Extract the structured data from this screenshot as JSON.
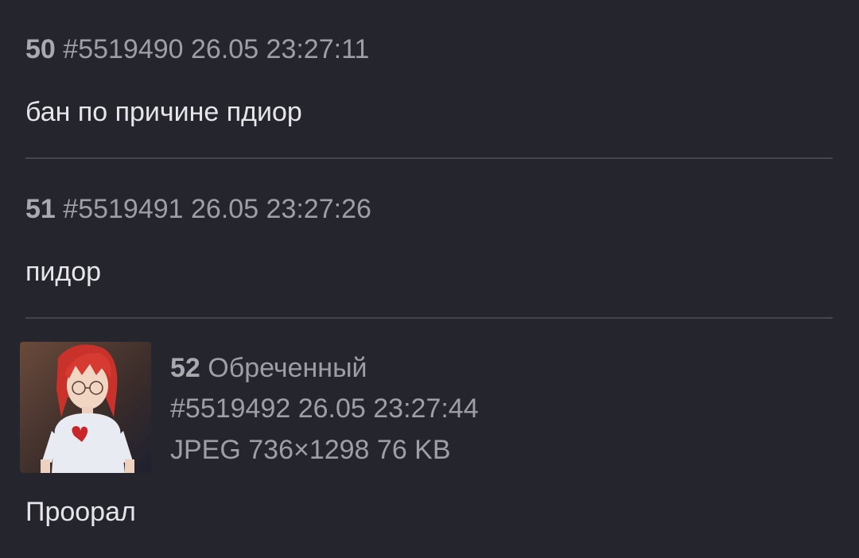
{
  "posts": [
    {
      "number": "50",
      "id": "#5519490",
      "datetime": "26.05 23:27:11",
      "text": "бан по причине пдиор"
    },
    {
      "number": "51",
      "id": "#5519491",
      "datetime": "26.05 23:27:26",
      "text": "пидор"
    },
    {
      "number": "52",
      "name": "Обреченный",
      "id": "#5519492",
      "datetime": "26.05 23:27:44",
      "file_info": "JPEG 736×1298 76 KB",
      "text": "Проорал"
    }
  ],
  "colors": {
    "background": "#25252d",
    "meta_text": "#9e9ea6",
    "body_text": "#e6e6ea",
    "divider": "#45454f"
  }
}
